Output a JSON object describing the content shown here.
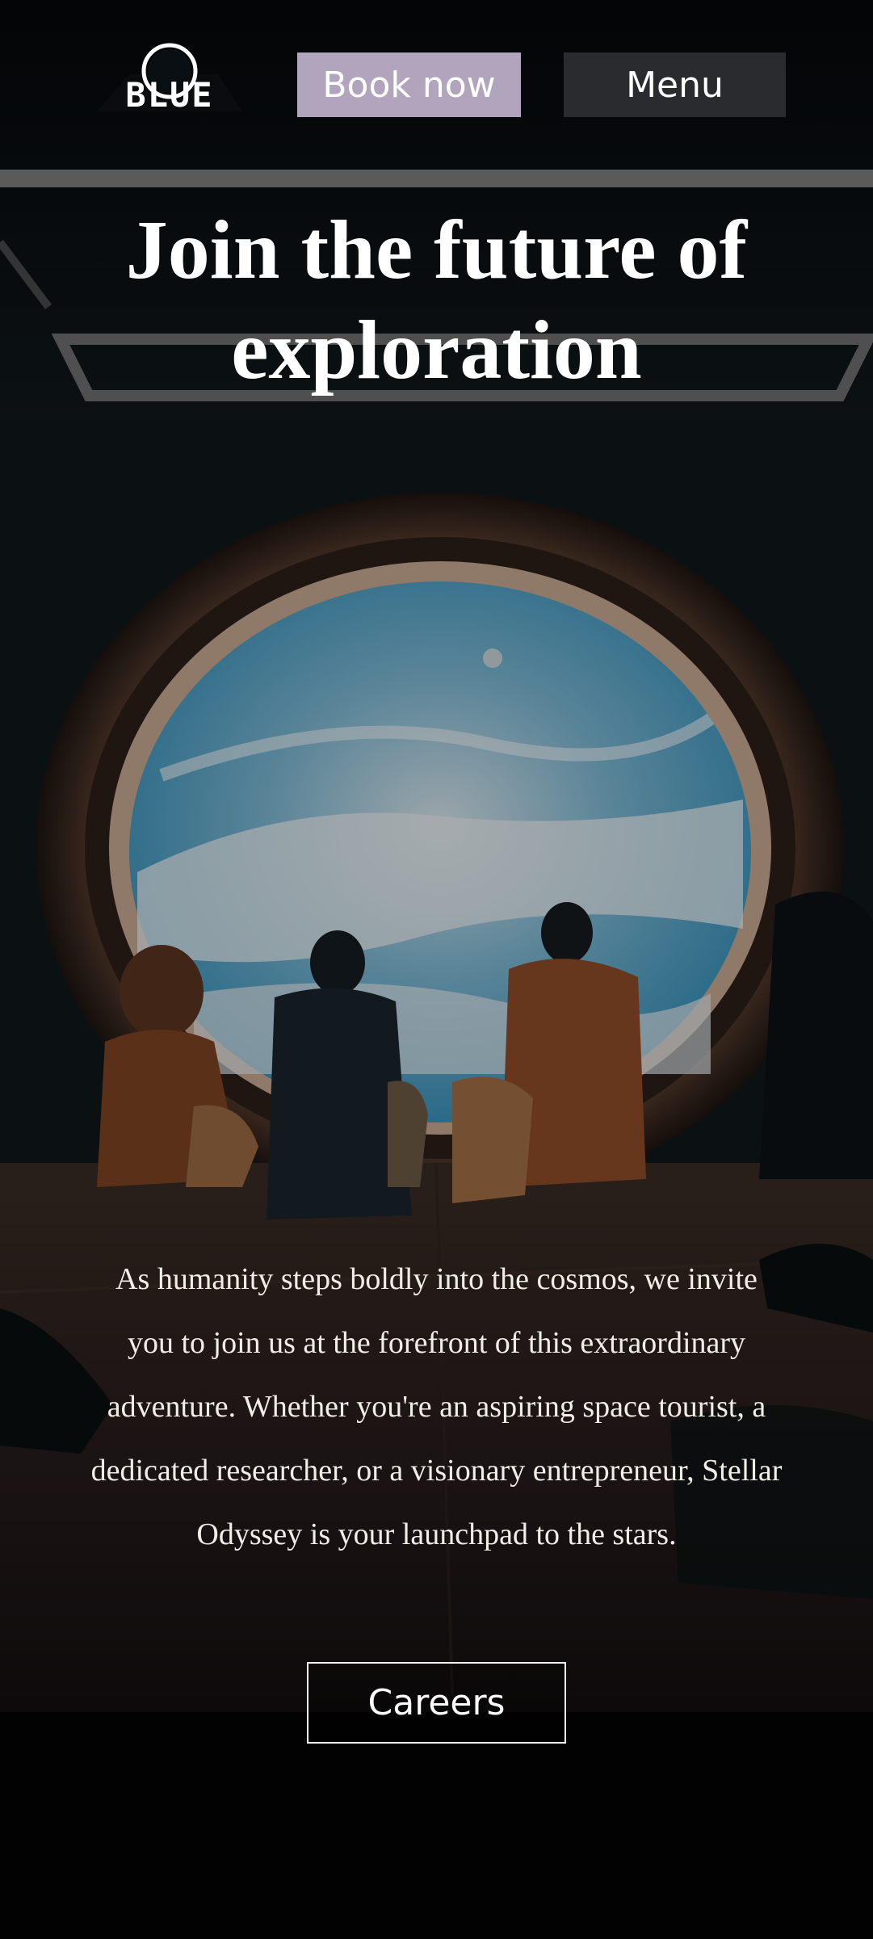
{
  "brand": {
    "logo_text": "BLUE",
    "logo_name": "stellar-odyssey-logo"
  },
  "header": {
    "book_label": "Book now",
    "menu_label": "Menu"
  },
  "hero": {
    "headline": "Join the future of exploration",
    "body": "As humanity steps boldly into the cosmos, we invite you to join us at the forefront of this extraordinary adventure. Whether you're an aspiring space tourist, a dedicated researcher, or a visionary entrepreneur, Stellar Odyssey is your launchpad to the stars.",
    "careers_label": "Careers",
    "image_subject": "people-looking-out-porthole"
  },
  "colors": {
    "book_button": "#b1a4bd",
    "menu_button": "#2a2b2e",
    "background": "#050709",
    "sky": "#3f9ec4"
  }
}
